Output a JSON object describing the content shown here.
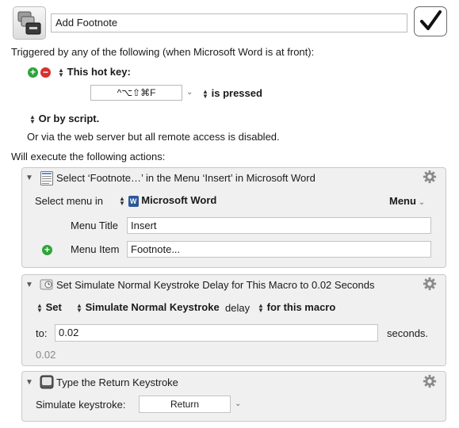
{
  "macro": {
    "name": "Add Footnote",
    "enabled": true
  },
  "trigger": {
    "intro": "Triggered by any of the following (when Microsoft Word is at front):",
    "hotkey_label": "This hot key:",
    "hotkey_value": "^⌥⇧⌘F",
    "hotkey_condition": "is pressed",
    "script_label": "Or by script.",
    "webserver_text": "Or via the web server but all remote access is disabled."
  },
  "actions_header": "Will execute the following actions:",
  "actions": [
    {
      "title": "Select ‘Footnote…’ in the Menu ‘Insert’ in Microsoft Word",
      "select_menu_in_label": "Select menu in",
      "app_name": "Microsoft Word",
      "menu_popup": "Menu",
      "menu_title_label": "Menu Title",
      "menu_title_value": "Insert",
      "menu_item_label": "Menu Item",
      "menu_item_value": "Footnote..."
    },
    {
      "title": "Set Simulate Normal Keystroke Delay for This Macro to 0.02 Seconds",
      "set_label": "Set",
      "which_label": "Simulate Normal Keystroke",
      "delay_label": "delay",
      "scope_label": "for this macro",
      "to_label": "to:",
      "to_value": "0.02",
      "unit_label": "seconds.",
      "preview_value": "0.02"
    },
    {
      "title": "Type the Return Keystroke",
      "simulate_label": "Simulate keystroke:",
      "keystroke_value": "Return"
    }
  ],
  "colors": {
    "panel_bg": "#f0f0f0",
    "add_green": "#2fa43a",
    "remove_red": "#d93030",
    "gear_grey": "#8a8a8a",
    "word_blue": "#2b579a"
  }
}
